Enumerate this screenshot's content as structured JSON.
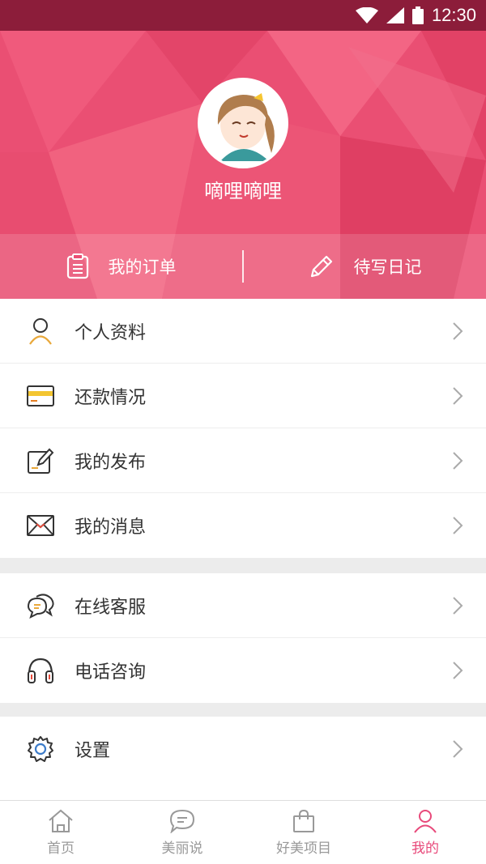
{
  "status_bar": {
    "time": "12:30"
  },
  "profile": {
    "username": "嘀哩嘀哩"
  },
  "quick_actions": [
    {
      "label": "我的订单",
      "icon": "order-icon"
    },
    {
      "label": "待写日记",
      "icon": "pencil-icon"
    }
  ],
  "menu_groups": [
    [
      {
        "label": "个人资料",
        "icon": "person-icon"
      },
      {
        "label": "还款情况",
        "icon": "card-icon"
      },
      {
        "label": "我的发布",
        "icon": "edit-note-icon"
      },
      {
        "label": "我的消息",
        "icon": "mail-icon"
      }
    ],
    [
      {
        "label": "在线客服",
        "icon": "chat-icon"
      },
      {
        "label": "电话咨询",
        "icon": "headphones-icon"
      }
    ],
    [
      {
        "label": "设置",
        "icon": "gear-icon"
      }
    ]
  ],
  "bottom_nav": [
    {
      "label": "首页",
      "icon": "home-icon",
      "active": false
    },
    {
      "label": "美丽说",
      "icon": "message-icon",
      "active": false
    },
    {
      "label": "好美项目",
      "icon": "bag-icon",
      "active": false
    },
    {
      "label": "我的",
      "icon": "user-icon",
      "active": true
    }
  ],
  "colors": {
    "accent": "#e8497a",
    "header": "#ea4f73",
    "status_bar": "#8c1d3a"
  }
}
